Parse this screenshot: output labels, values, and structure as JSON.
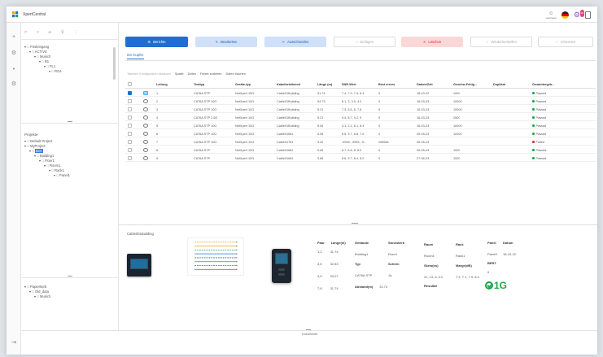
{
  "app": {
    "title": "XpertCentral"
  },
  "titlebar": {
    "user_label": "username"
  },
  "notifications": {
    "count": "99"
  },
  "left": {
    "tree1": [
      {
        "label": "Posteingang",
        "level": 0,
        "icon": "inbox"
      },
      {
        "label": "ACTIVE",
        "level": 1,
        "icon": "folder"
      },
      {
        "label": "Munich",
        "level": 2,
        "icon": "building"
      },
      {
        "label": "B1",
        "level": 3,
        "icon": "building"
      },
      {
        "label": "FL1",
        "level": 4,
        "icon": "floor"
      },
      {
        "label": "RO4",
        "level": 5,
        "icon": "room"
      }
    ],
    "projects_title": "Projekte",
    "projects": [
      {
        "label": "Default Project",
        "level": 0
      },
      {
        "label": "MyProject",
        "level": 0
      },
      {
        "label": "Bert",
        "level": 1,
        "selected": true
      },
      {
        "label": "Building1",
        "level": 2
      },
      {
        "label": "Floor1",
        "level": 3
      },
      {
        "label": "Room1",
        "level": 4
      },
      {
        "label": "Rack1",
        "level": 5
      },
      {
        "label": "Panel1",
        "level": 6
      }
    ],
    "trash": [
      {
        "label": "Papierkorb",
        "level": 0
      },
      {
        "label": "Old_data",
        "level": 1
      },
      {
        "label": "Munich",
        "level": 2
      }
    ]
  },
  "toolbar": {
    "report": "Berichte",
    "edit": "Bearbeiten",
    "cut": "Ausschneiden",
    "paste": "Einfügen",
    "delete": "Löschen",
    "restore": "Wiederherstellen",
    "rename": "Erkennen"
  },
  "tab": "6G Kupfer",
  "subtools": [
    "Tabellen Konfiguration ablassen",
    "Spalte",
    "Zeilen",
    "Felder sortieren",
    "Daten löschen"
  ],
  "table": {
    "headers": [
      "Leitung",
      "Testtyp",
      "Geräte-typ",
      "Kabelbeleikennt",
      "Länge (m)",
      "SNR-Wert",
      "Best errors",
      "Datum/Zeit",
      "Geschw-Fehlg...",
      "Duplikat",
      "Gesamtergeb..."
    ],
    "rows": [
      [
        "1",
        "CAT6A STP",
        "NetXpert 10G",
        "Cable01Building",
        "31.74",
        "7.4, 7.9, 7.9, 8.4",
        "0",
        "18-10-22",
        "1000",
        "",
        "Passed"
      ],
      [
        "2",
        "CAT6A STP 10G",
        "NetXpert 10G",
        "Cable01Building",
        "94.73",
        "8.1, 3, 3.9, 4.0",
        "0",
        "16-03-23",
        "10000",
        "",
        "Passed"
      ],
      [
        "3",
        "CAT6A STP 10G",
        "NetXpert 10G",
        "Cable01Building",
        "5.21",
        "7.3, 5.6, 8, 7.8",
        "0",
        "16-03-23",
        "10000",
        "",
        "Passed"
      ],
      [
        "4",
        "CAT6A STP 2.5G",
        "NetXpert 10G",
        "Cable01Building",
        "5.21",
        "9.4, 8.7, 9.2, 9",
        "0",
        "16-03-23",
        "2500",
        "",
        "Passed"
      ],
      [
        "5",
        "CAT6A STP 10G",
        "NetXpert 10G",
        "Cable01Building",
        "5.06",
        "3.1, 2.2, 6.1, 8.4",
        "0",
        "16-03-23",
        "10000",
        "",
        "Passed"
      ],
      [
        "6",
        "CAT6A STP 10G",
        "NetXpert 10G",
        "Cable01681",
        "5.06",
        "6.5, 9.7, 6.8, 7.6",
        "0",
        "09-05-23",
        "10000",
        "",
        "Passed"
      ],
      [
        "7",
        "CAT6A STP 10G",
        "NetXpert 10G",
        "Cable01781",
        "3.32",
        "-9999, -9999, -9...",
        "255554",
        "05-05-23",
        "",
        "",
        "Failed"
      ],
      [
        "8",
        "CAT6A STP",
        "NetXpert 10G",
        "Cable01681",
        "5.06",
        "6.7, 6.8, 8, 8.0",
        "0",
        "09-05-23",
        "1000",
        "",
        "Passed"
      ],
      [
        "9",
        "CAT6A STP",
        "NetXpert 10G",
        "Cable01681",
        "5.68",
        "8.6, 9.7, 8.4, 8.5",
        "0",
        "27-06-23",
        "1000",
        "",
        "Passed"
      ]
    ],
    "row_checked": [
      true,
      false,
      false,
      false,
      false,
      false,
      false,
      false,
      false
    ],
    "row_active": [
      true,
      false,
      false,
      false,
      false,
      false,
      false,
      false,
      false
    ],
    "status_colors": {
      "Passed": "#1ca64c",
      "Failed": "#d93030"
    }
  },
  "detail": {
    "name": "Cable001Building",
    "pairs_head": [
      "Paar",
      "Länge(m)"
    ],
    "pairs": [
      [
        "1,2",
        "31.74"
      ],
      [
        "3,6",
        "32.83"
      ],
      [
        "4,5",
        "33.07"
      ],
      [
        "7,8",
        "31.74"
      ]
    ],
    "building_label": "Gebäude",
    "building": "Building1",
    "floor_label": "Stockwerk",
    "floor": "Floor1",
    "room_label": "Raum",
    "room": "Room1",
    "rack_label": "Rack",
    "rack": "Rack1",
    "panel_label": "Panel",
    "panel": "Panel1",
    "date_label": "Datum",
    "date": "18-10-22",
    "type_label": "Typ",
    "type": "CAT6A STP",
    "shield_label": "Schirm",
    "shield": "Ja",
    "skew_label": "Skew(ns)",
    "skew": "21, 13, 6, 0.0",
    "margin_label": "Marge(dB)",
    "margin": "7.4, 7.1, 7.9, 8.4",
    "bert_label": "BERT",
    "bert": "0",
    "distance_label": "Abstand(m)",
    "distance": "31.74",
    "result_label": "Resultat",
    "cert": "1G"
  },
  "footer": {
    "label": "Dokumente"
  }
}
